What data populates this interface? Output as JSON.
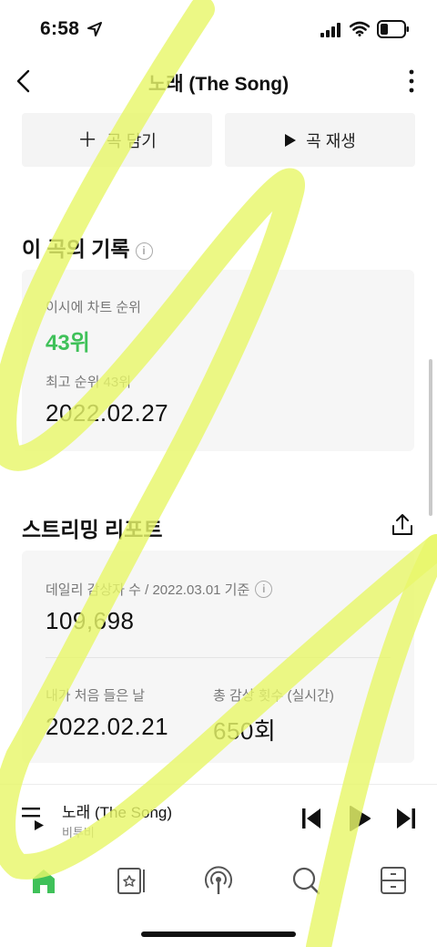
{
  "status_bar": {
    "time": "6:58"
  },
  "nav": {
    "title": "노래 (The Song)"
  },
  "actions": {
    "add_label": "곡 담기",
    "play_label": "곡 재생"
  },
  "song_record": {
    "title": "이 곡의 기록",
    "chart_label": "이시에 차트 순위",
    "chart_rank": "43위",
    "best_label": "최고 순위 43위",
    "best_date": "2022.02.27"
  },
  "streaming_report": {
    "title": "스트리밍 리포트",
    "daily_label": "데일리 감상자 수 / 2022.03.01 기준",
    "daily_value": "109,698",
    "first_listen_label": "내가 처음 들은 날",
    "first_listen_value": "2022.02.21",
    "total_plays_label": "총 감상 횟수 (실시간)",
    "total_plays_value": "650회"
  },
  "mini_player": {
    "title": "노래 (The Song)",
    "artist": "비투비"
  },
  "colors": {
    "rank_green": "#3fc159",
    "active_tab": "#3fc159",
    "highlight": "#e8f76a"
  },
  "tabs": [
    "home-icon",
    "playlist-icon",
    "podcast-icon",
    "search-icon",
    "library-icon"
  ]
}
